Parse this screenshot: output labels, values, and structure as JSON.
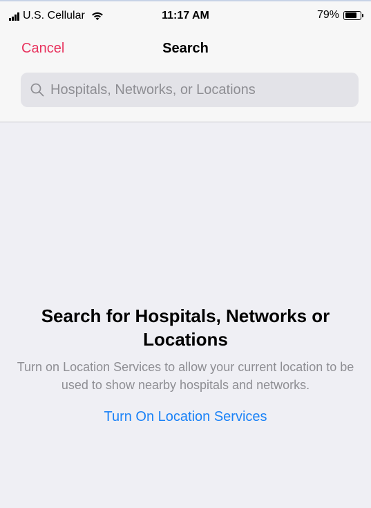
{
  "status_bar": {
    "carrier": "U.S. Cellular",
    "time": "11:17 AM",
    "battery_percent": "79%",
    "battery_level": 0.79,
    "icons": [
      "signal-icon",
      "wifi-icon",
      "battery-icon"
    ]
  },
  "nav": {
    "cancel_label": "Cancel",
    "title": "Search"
  },
  "search": {
    "placeholder": "Hospitals, Networks, or Locations",
    "value": "",
    "icon": "search-icon"
  },
  "empty_state": {
    "title": "Search for Hospitals, Networks or Locations",
    "description": "Turn on Location Services to allow your current location to be used to show nearby hospitals and networks.",
    "action_label": "Turn On Location Services"
  },
  "colors": {
    "accent_red": "#e8325d",
    "link_blue": "#1a82f7",
    "background": "#efeff4",
    "nav_background": "#f7f7f7",
    "secondary_text": "#8e8e93"
  }
}
